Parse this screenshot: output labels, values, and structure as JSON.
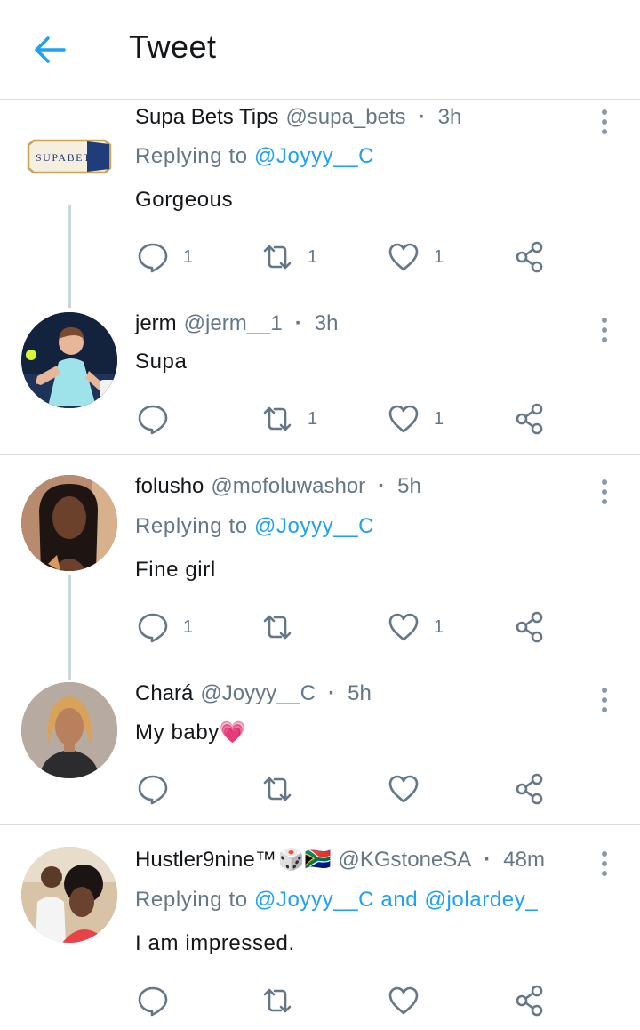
{
  "header": {
    "title": "Tweet",
    "back_icon": "arrow-left-icon",
    "accent": "#1da1f2"
  },
  "tweets": [
    {
      "name": "Supa Bets Tips",
      "handle": "@supa_bets",
      "separator": "·",
      "time": "3h",
      "replying_prefix": "Replying to",
      "replying_to": "@Joyyy__C",
      "text": "Gorgeous",
      "avatar_text": "SUPABETS",
      "replies": "1",
      "retweets": "1",
      "likes": "1"
    },
    {
      "name": "jerm",
      "handle": "@jerm__1",
      "separator": "·",
      "time": "3h",
      "text": "Supa",
      "replies": "",
      "retweets": "1",
      "likes": "1"
    },
    {
      "name": "folusho",
      "handle": "@mofoluwashor",
      "separator": "·",
      "time": "5h",
      "replying_prefix": "Replying to",
      "replying_to": "@Joyyy__C",
      "text": "Fine girl",
      "replies": "1",
      "retweets": "",
      "likes": "1"
    },
    {
      "name": "Chará",
      "handle": "@Joyyy__C",
      "separator": "·",
      "time": "5h",
      "text": "My baby",
      "emoji": "💗",
      "replies": "",
      "retweets": "",
      "likes": ""
    },
    {
      "name": "Hustler9nine™",
      "name_emoji": "🎲🇿🇦",
      "handle": "@KGstoneSA",
      "separator": "·",
      "time": "48m",
      "replying_prefix": "Replying to",
      "replying_to": "@Joyyy__C",
      "replying_and": "and",
      "replying_to_2": "@jolardey_",
      "text": "I am impressed.",
      "replies": "",
      "retweets": "",
      "likes": ""
    }
  ]
}
